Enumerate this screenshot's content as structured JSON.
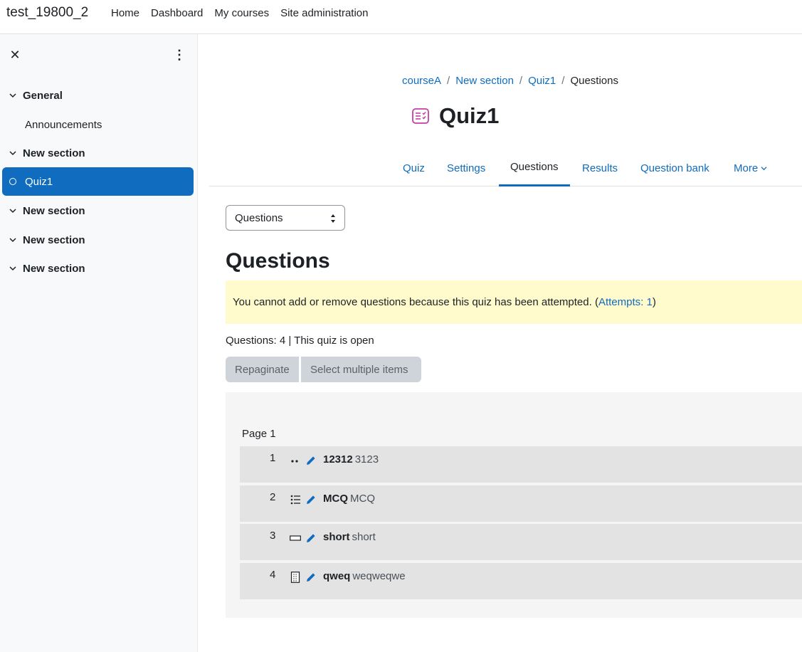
{
  "navbar": {
    "brand": "test_19800_2",
    "links": [
      "Home",
      "Dashboard",
      "My courses",
      "Site administration"
    ]
  },
  "drawer": {
    "sections": [
      {
        "label": "General"
      },
      {
        "label": "New section"
      },
      {
        "label": "New section"
      },
      {
        "label": "New section"
      },
      {
        "label": "New section"
      }
    ],
    "items": [
      {
        "label": "Announcements"
      },
      {
        "label": "Quiz1"
      }
    ]
  },
  "breadcrumb": [
    "courseA",
    "New section",
    "Quiz1",
    "Questions"
  ],
  "page_title": "Quiz1",
  "tabs": [
    "Quiz",
    "Settings",
    "Questions",
    "Results",
    "Question bank",
    "More"
  ],
  "active_tab": "Questions",
  "select": {
    "value": "Questions"
  },
  "heading": "Questions",
  "alert": {
    "text": "You cannot add or remove questions because this quiz has been attempted. (",
    "link": "Attempts: 1",
    "suffix": ")"
  },
  "status": "Questions: 4 | This quiz is open",
  "buttons": {
    "repaginate": "Repaginate",
    "select_multiple": "Select multiple items"
  },
  "page_label": "Page 1",
  "questions": [
    {
      "num": "1",
      "name": "12312",
      "desc": "3123",
      "icon": "dots-icon"
    },
    {
      "num": "2",
      "name": "MCQ",
      "desc": "MCQ",
      "icon": "list-icon"
    },
    {
      "num": "3",
      "name": "short",
      "desc": "short",
      "icon": "short-answer-icon"
    },
    {
      "num": "4",
      "name": "qweq",
      "desc": "weqweqwe",
      "icon": "essay-icon"
    }
  ],
  "colors": {
    "accent": "#0f6cbf",
    "quiz_icon": "#c73da8",
    "alert_bg": "#fffbcc"
  }
}
